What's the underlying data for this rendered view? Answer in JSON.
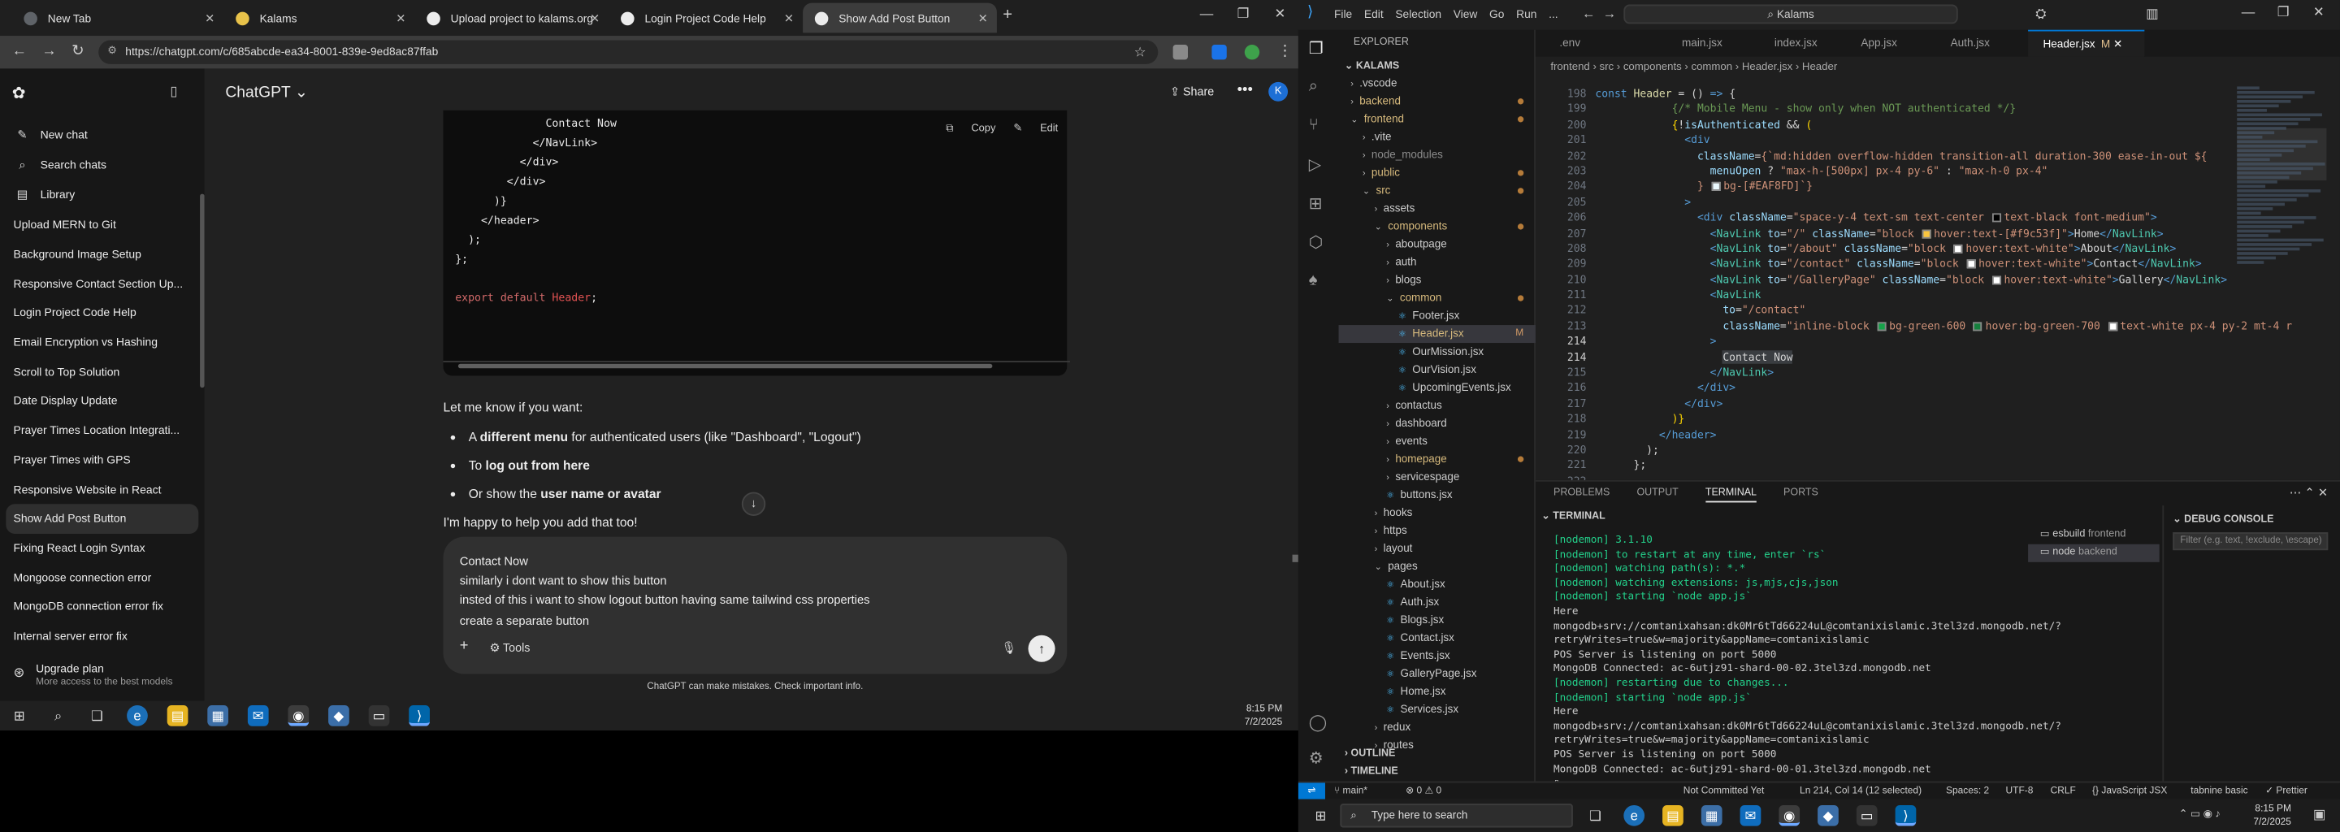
{
  "chrome": {
    "tabs": [
      {
        "label": "New Tab",
        "color": "#5f6368"
      },
      {
        "label": "Kalams",
        "color": "#e8c24a"
      },
      {
        "label": "Upload project to kalams.org",
        "color": "#ececec"
      },
      {
        "label": "Login Project Code Help",
        "color": "#ececec"
      },
      {
        "label": "Show Add Post Button",
        "color": "#ececec"
      }
    ],
    "url": "https://chatgpt.com/c/685abcde-ea34-8001-839e-9ed8ac87ffab"
  },
  "sidebar": {
    "top": [
      {
        "icon": "new-chat-icon",
        "label": "New chat"
      },
      {
        "icon": "search-icon",
        "label": "Search chats"
      },
      {
        "icon": "library-icon",
        "label": "Library"
      }
    ],
    "chats": [
      "Upload MERN to Git",
      "Background Image Setup",
      "Responsive Contact Section Up...",
      "Login Project Code Help",
      "Email Encryption vs Hashing",
      "Scroll to Top Solution",
      "Date Display Update",
      "Prayer Times Location Integrati...",
      "Prayer Times with GPS",
      "Responsive Website in React",
      "Show Add Post Button",
      "Fixing React Login Syntax",
      "Mongoose connection error",
      "MongoDB connection error fix",
      "Internal server error fix"
    ],
    "active_chat": "Show Add Post Button",
    "upgrade_title": "Upgrade plan",
    "upgrade_sub": "More access to the best models"
  },
  "chat": {
    "model": "ChatGPT",
    "share": "Share",
    "avatar": "K",
    "copy": "Copy",
    "edit": "Edit",
    "code_lines": [
      "              Contact Now",
      "            </NavLink>",
      "          </div>",
      "        </div>",
      "      )}",
      "    </header>",
      "  );",
      "};",
      "",
      "export default Header;"
    ],
    "reply_intro": "Let me know if you want:",
    "bullets": [
      {
        "pre": "A ",
        "bold": "different menu",
        "post": " for authenticated users (like \"Dashboard\", \"Logout\")"
      },
      {
        "pre": "To ",
        "bold": "log out from here",
        "post": ""
      },
      {
        "pre": "Or show the ",
        "bold": "user name or avatar",
        "post": ""
      }
    ],
    "reply_tail": "I'm happy to help you add that too!",
    "composer_text": "Contact Now\nsimilarly i dont want to show this button\ninsted of this i want to show logout button having same tailwind css properties\ncreate a separate button",
    "tools": "Tools",
    "disclaimer": "ChatGPT can make mistakes. Check important info."
  },
  "chrome_clock": {
    "time": "8:15 PM",
    "date": "7/2/2025"
  },
  "vscode": {
    "menu": [
      "File",
      "Edit",
      "Selection",
      "View",
      "Go",
      "Run",
      "..."
    ],
    "search": "Kalams",
    "explorer_title": "EXPLORER",
    "root": "KALAMS",
    "tree": [
      {
        "d": 1,
        "n": ".vscode",
        "t": "closed"
      },
      {
        "d": 1,
        "n": "backend",
        "t": "closed",
        "dot": true,
        "git": true
      },
      {
        "d": 1,
        "n": "frontend",
        "t": "open",
        "dot": true,
        "git": true
      },
      {
        "d": 2,
        "n": ".vite",
        "t": "closed"
      },
      {
        "d": 2,
        "n": "node_modules",
        "t": "closed",
        "dim": true
      },
      {
        "d": 2,
        "n": "public",
        "t": "closed",
        "dot": true,
        "git": true
      },
      {
        "d": 2,
        "n": "src",
        "t": "open",
        "dot": true,
        "git": true
      },
      {
        "d": 3,
        "n": "assets",
        "t": "closed"
      },
      {
        "d": 3,
        "n": "components",
        "t": "open",
        "dot": true,
        "git": true
      },
      {
        "d": 4,
        "n": "aboutpage",
        "t": "closed"
      },
      {
        "d": 4,
        "n": "auth",
        "t": "closed"
      },
      {
        "d": 4,
        "n": "blogs",
        "t": "closed"
      },
      {
        "d": 4,
        "n": "common",
        "t": "open",
        "dot": true,
        "git": true
      },
      {
        "d": 5,
        "n": "Footer.jsx",
        "t": "file"
      },
      {
        "d": 5,
        "n": "Header.jsx",
        "t": "file",
        "sel": true,
        "flag": "M",
        "git": true
      },
      {
        "d": 5,
        "n": "OurMission.jsx",
        "t": "file"
      },
      {
        "d": 5,
        "n": "OurVision.jsx",
        "t": "file"
      },
      {
        "d": 5,
        "n": "UpcomingEvents.jsx",
        "t": "file"
      },
      {
        "d": 4,
        "n": "contactus",
        "t": "closed"
      },
      {
        "d": 4,
        "n": "dashboard",
        "t": "closed"
      },
      {
        "d": 4,
        "n": "events",
        "t": "closed"
      },
      {
        "d": 4,
        "n": "homepage",
        "t": "closed",
        "dot": true,
        "git": true
      },
      {
        "d": 4,
        "n": "servicespage",
        "t": "closed"
      },
      {
        "d": 4,
        "n": "buttons.jsx",
        "t": "file"
      },
      {
        "d": 3,
        "n": "hooks",
        "t": "closed"
      },
      {
        "d": 3,
        "n": "https",
        "t": "closed"
      },
      {
        "d": 3,
        "n": "layout",
        "t": "closed"
      },
      {
        "d": 3,
        "n": "pages",
        "t": "open"
      },
      {
        "d": 4,
        "n": "About.jsx",
        "t": "file"
      },
      {
        "d": 4,
        "n": "Auth.jsx",
        "t": "file"
      },
      {
        "d": 4,
        "n": "Blogs.jsx",
        "t": "file"
      },
      {
        "d": 4,
        "n": "Contact.jsx",
        "t": "file"
      },
      {
        "d": 4,
        "n": "Events.jsx",
        "t": "file"
      },
      {
        "d": 4,
        "n": "GalleryPage.jsx",
        "t": "file"
      },
      {
        "d": 4,
        "n": "Home.jsx",
        "t": "file"
      },
      {
        "d": 4,
        "n": "Services.jsx",
        "t": "file"
      },
      {
        "d": 3,
        "n": "redux",
        "t": "closed"
      },
      {
        "d": 3,
        "n": "routes",
        "t": "closed"
      }
    ],
    "outline": "OUTLINE",
    "timeline": "TIMELINE",
    "tabs": [
      {
        "label": ".env"
      },
      {
        "label": "main.jsx"
      },
      {
        "label": "index.jsx"
      },
      {
        "label": "App.jsx"
      },
      {
        "label": "Auth.jsx"
      },
      {
        "label": "Header.jsx",
        "active": true,
        "mod": "M"
      }
    ],
    "breadcrumb": "frontend › src › components › common › Header.jsx › Header",
    "code": [
      {
        "n": "198",
        "h": "<span class='c-kw'>const</span> <span class='c-fn'>Header</span> = () <span class='c-kw'>=&gt;</span> {"
      },
      {
        "n": "199",
        "h": "            <span class='c-cm'>{/* Mobile Menu - show only when NOT authenticated */}</span>"
      },
      {
        "n": "200",
        "h": "            <span class='c-brk'>{</span>!<span class='c-var'>isAuthenticated</span> &amp;&amp; <span class='c-brk'>(</span>"
      },
      {
        "n": "201",
        "h": "              <span class='c-tag'>&lt;div</span>"
      },
      {
        "n": "202",
        "h": "                <span class='c-at'>className</span>=<span class='c-str'>{`md:hidden overflow-hidden transition-all duration-300 ease-in-out ${</span>"
      },
      {
        "n": "203",
        "h": "                  <span class='c-var'>menuOpen</span> ? <span class='c-str'>\"max-h-[500px] px-4 py-6\"</span> : <span class='c-str'>\"max-h-0 px-4\"</span>"
      },
      {
        "n": "204",
        "h": "                <span class='c-str'>} <i class='sw' style='background:#EAF8FD'></i>bg-[#EAF8FD]`}</span>"
      },
      {
        "n": "205",
        "h": "              <span class='c-tag'>&gt;</span>"
      },
      {
        "n": "206",
        "h": "                <span class='c-tag'>&lt;div</span> <span class='c-at'>className</span>=<span class='c-str'>\"space-y-4 text-sm text-center <i class='sw' style='background:#000'></i>text-black font-medium\"</span><span class='c-tag'>&gt;</span>"
      },
      {
        "n": "207",
        "h": "                  <span class='c-tag'>&lt;</span><span class='c-cmp'>NavLink</span> <span class='c-at'>to</span>=<span class='c-str'>\"/\"</span> <span class='c-at'>className</span>=<span class='c-str'>\"block <i class='sw' style='background:#f9c53f'></i>hover:text-[#f9c53f]\"</span><span class='c-tag'>&gt;</span>Home<span class='c-tag'>&lt;/</span><span class='c-cmp'>NavLink</span><span class='c-tag'>&gt;</span>"
      },
      {
        "n": "208",
        "h": "                  <span class='c-tag'>&lt;</span><span class='c-cmp'>NavLink</span> <span class='c-at'>to</span>=<span class='c-str'>\"/about\"</span> <span class='c-at'>className</span>=<span class='c-str'>\"block <i class='sw' style='background:#fff'></i>hover:text-white\"</span><span class='c-tag'>&gt;</span>About<span class='c-tag'>&lt;/</span><span class='c-cmp'>NavLink</span><span class='c-tag'>&gt;</span>"
      },
      {
        "n": "209",
        "h": "                  <span class='c-tag'>&lt;</span><span class='c-cmp'>NavLink</span> <span class='c-at'>to</span>=<span class='c-str'>\"/contact\"</span> <span class='c-at'>className</span>=<span class='c-str'>\"block <i class='sw' style='background:#fff'></i>hover:text-white\"</span><span class='c-tag'>&gt;</span>Contact<span class='c-tag'>&lt;/</span><span class='c-cmp'>NavLink</span><span class='c-tag'>&gt;</span>"
      },
      {
        "n": "210",
        "h": "                  <span class='c-tag'>&lt;</span><span class='c-cmp'>NavLink</span> <span class='c-at'>to</span>=<span class='c-str'>\"/GalleryPage\"</span> <span class='c-at'>className</span>=<span class='c-str'>\"block <i class='sw' style='background:#fff'></i>hover:text-white\"</span><span class='c-tag'>&gt;</span>Gallery<span class='c-tag'>&lt;/</span><span class='c-cmp'>NavLink</span><span class='c-tag'>&gt;</span>"
      },
      {
        "n": "211",
        "h": "                  <span class='c-tag'>&lt;</span><span class='c-cmp'>NavLink</span>"
      },
      {
        "n": "212",
        "h": "                    <span class='c-at'>to</span>=<span class='c-str'>\"/contact\"</span>"
      },
      {
        "n": "213",
        "h": "                    <span class='c-at'>className</span>=<span class='c-str'>\"inline-block <i class='sw' style='background:#16a34a'></i>bg-green-600 <i class='sw' style='background:#15803d'></i>hover:bg-green-700 <i class='sw' style='background:#fff'></i>text-white px-4 py-2 mt-4 r</span>"
      },
      {
        "n": "214",
        "h": "                  <span class='c-tag'>&gt;</span>",
        "cur": true
      },
      {
        "n": "214",
        "h": "                    <span style='background:#3a3d41'>Contact Now</span>",
        "cur": true
      },
      {
        "n": "215",
        "h": "                  <span class='c-tag'>&lt;/</span><span class='c-cmp'>NavLink</span><span class='c-tag'>&gt;</span>"
      },
      {
        "n": "216",
        "h": "                <span class='c-tag'>&lt;/div&gt;</span>"
      },
      {
        "n": "217",
        "h": "              <span class='c-tag'>&lt;/div&gt;</span>"
      },
      {
        "n": "218",
        "h": "            <span class='c-brk'>)}</span>"
      },
      {
        "n": "219",
        "h": "          <span class='c-tag'>&lt;/header&gt;</span>"
      },
      {
        "n": "220",
        "h": "        );"
      },
      {
        "n": "221",
        "h": "      };"
      },
      {
        "n": "222",
        "h": ""
      }
    ],
    "panel_tabs": [
      "PROBLEMS",
      "OUTPUT",
      "TERMINAL",
      "PORTS"
    ],
    "panel_active": "TERMINAL",
    "terminal_title": "TERMINAL",
    "terminal": [
      {
        "c": "t-g",
        "t": "[nodemon] 3.1.10"
      },
      {
        "c": "t-g",
        "t": "[nodemon] to restart at any time, enter `rs`"
      },
      {
        "c": "t-g",
        "t": "[nodemon] watching path(s): *.*"
      },
      {
        "c": "t-g",
        "t": "[nodemon] watching extensions: js,mjs,cjs,json"
      },
      {
        "c": "t-g",
        "t": "[nodemon] starting `node app.js`"
      },
      {
        "c": "",
        "t": "Here"
      },
      {
        "c": "",
        "t": "mongodb+srv://comtanixahsan:dk0Mr6tTd66224uL@comtanixislamic.3tel3zd.mongodb.net/?"
      },
      {
        "c": "",
        "t": "retryWrites=true&w=majority&appName=comtanixislamic"
      },
      {
        "c": "",
        "t": "POS Server is listening on port 5000"
      },
      {
        "c": "",
        "t": "MongoDB Connected: ac-6utjz91-shard-00-02.3tel3zd.mongodb.net"
      },
      {
        "c": "t-g",
        "t": "[nodemon] restarting due to changes..."
      },
      {
        "c": "t-g",
        "t": "[nodemon] starting `node app.js`"
      },
      {
        "c": "",
        "t": "Here"
      },
      {
        "c": "",
        "t": "mongodb+srv://comtanixahsan:dk0Mr6tTd66224uL@comtanixislamic.3tel3zd.mongodb.net/?"
      },
      {
        "c": "",
        "t": "retryWrites=true&w=majority&appName=comtanixislamic"
      },
      {
        "c": "",
        "t": "POS Server is listening on port 5000"
      },
      {
        "c": "",
        "t": "MongoDB Connected: ac-6utjz91-shard-00-01.3tel3zd.mongodb.net"
      }
    ],
    "term_list": [
      {
        "name": "esbuild",
        "sub": "frontend"
      },
      {
        "name": "node",
        "sub": "backend",
        "sel": true
      }
    ],
    "debug_title": "DEBUG CONSOLE",
    "debug_placeholder": "Filter (e.g. text, !exclude, \\escape)",
    "status": {
      "branch": "main*",
      "errors": "⊗ 0 ⚠ 0",
      "git": "Not Committed Yet",
      "pos": "Ln 214, Col 14 (12 selected)",
      "spaces": "Spaces: 2",
      "enc": "UTF-8",
      "eol": "CRLF",
      "lang": "{} JavaScript JSX",
      "tabnine": "tabnine basic",
      "prettier": "✓ Prettier"
    }
  },
  "win": {
    "search": "Type here to search",
    "time": "8:15 PM",
    "date": "7/2/2025"
  }
}
